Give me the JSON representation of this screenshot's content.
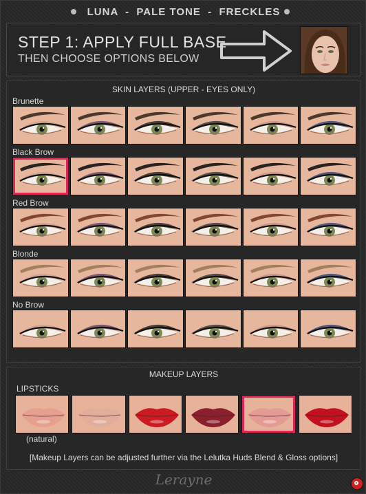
{
  "header": {
    "title": "LUNA  -  PALE TONE  -  FRECKLES"
  },
  "step": {
    "line1": "STEP 1: APPLY FULL BASE",
    "line2": "THEN CHOOSE OPTIONS BELOW"
  },
  "skin": {
    "title": "SKIN LAYERS (UPPER - EYES ONLY)",
    "rows": [
      {
        "label": "Brunette",
        "brow": "#3b2a20"
      },
      {
        "label": "Black Brow",
        "brow": "#141414"
      },
      {
        "label": "Red Brow",
        "brow": "#7a3a22"
      },
      {
        "label": "Blonde",
        "brow": "#9a7a55"
      },
      {
        "label": "No Brow",
        "brow": ""
      }
    ],
    "shadows": [
      "#c9a08a",
      "#5a3a5e",
      "#151515",
      "#2a2a2a",
      "#c48f86",
      "#243a6e"
    ],
    "selected": {
      "row": 1,
      "col": 0
    }
  },
  "makeup": {
    "title": "MAKEUP LAYERS",
    "subtitle": "LIPSTICKS",
    "lip_colors": [
      "#e7a090",
      "#e2ad9a",
      "#cc1a22",
      "#8a1f2e",
      "#e59b95",
      "#c2101f"
    ],
    "natural_label": "(natural)",
    "selected": 4,
    "note": "[Makeup Layers can be adjusted further via the Lelutka Huds Blend & Gloss options]"
  },
  "signature": "Lerayne",
  "colors": {
    "accent": "#e0245a",
    "power": "#d42020"
  }
}
